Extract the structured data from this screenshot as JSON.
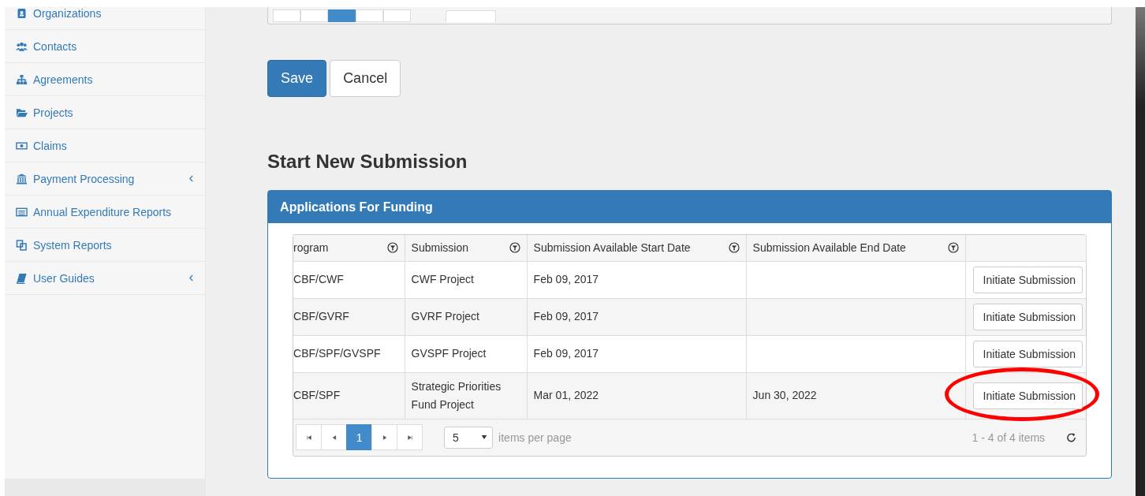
{
  "sidebar": {
    "items": [
      {
        "label": "Organizations",
        "expandable": false
      },
      {
        "label": "Contacts",
        "expandable": false
      },
      {
        "label": "Agreements",
        "expandable": false
      },
      {
        "label": "Projects",
        "expandable": false
      },
      {
        "label": "Claims",
        "expandable": false
      },
      {
        "label": "Payment Processing",
        "expandable": true
      },
      {
        "label": "Annual Expenditure Reports",
        "expandable": false
      },
      {
        "label": "System Reports",
        "expandable": false
      },
      {
        "label": "User Guides",
        "expandable": true
      }
    ]
  },
  "form_buttons": [
    {
      "label": "Save",
      "kind": "primary"
    },
    {
      "label": "Cancel",
      "kind": "default"
    }
  ],
  "heading": "Start New Submission",
  "panel": {
    "title": "Applications For Funding",
    "table": {
      "columns": [
        {
          "label": "rogram"
        },
        {
          "label": "Submission"
        },
        {
          "label": "Submission Available Start Date"
        },
        {
          "label": "Submission Available End Date"
        }
      ],
      "rows": [
        {
          "cells": [
            "CBF/CWF",
            "CWF Project",
            "Feb 09, 2017",
            ""
          ],
          "action": "Initiate Submission",
          "highlighted": false
        },
        {
          "cells": [
            "CBF/GVRF",
            "GVRF Project",
            "Feb 09, 2017",
            ""
          ],
          "action": "Initiate Submission",
          "highlighted": false
        },
        {
          "cells": [
            "CBF/SPF/GVSPF",
            "GVSPF Project",
            "Feb 09, 2017",
            ""
          ],
          "action": "Initiate Submission",
          "highlighted": false
        },
        {
          "cells": [
            "CBF/SPF",
            "Strategic Priorities Fund Project",
            "Mar 01, 2022",
            "Jun 30, 2022"
          ],
          "action": "Initiate Submission",
          "highlighted": true
        }
      ]
    },
    "pager": {
      "pages": [
        {
          "label": "1",
          "selected": true
        }
      ],
      "page_size": "5",
      "page_size_label": "items per page",
      "summary": "1 - 4 of 4 items"
    }
  }
}
